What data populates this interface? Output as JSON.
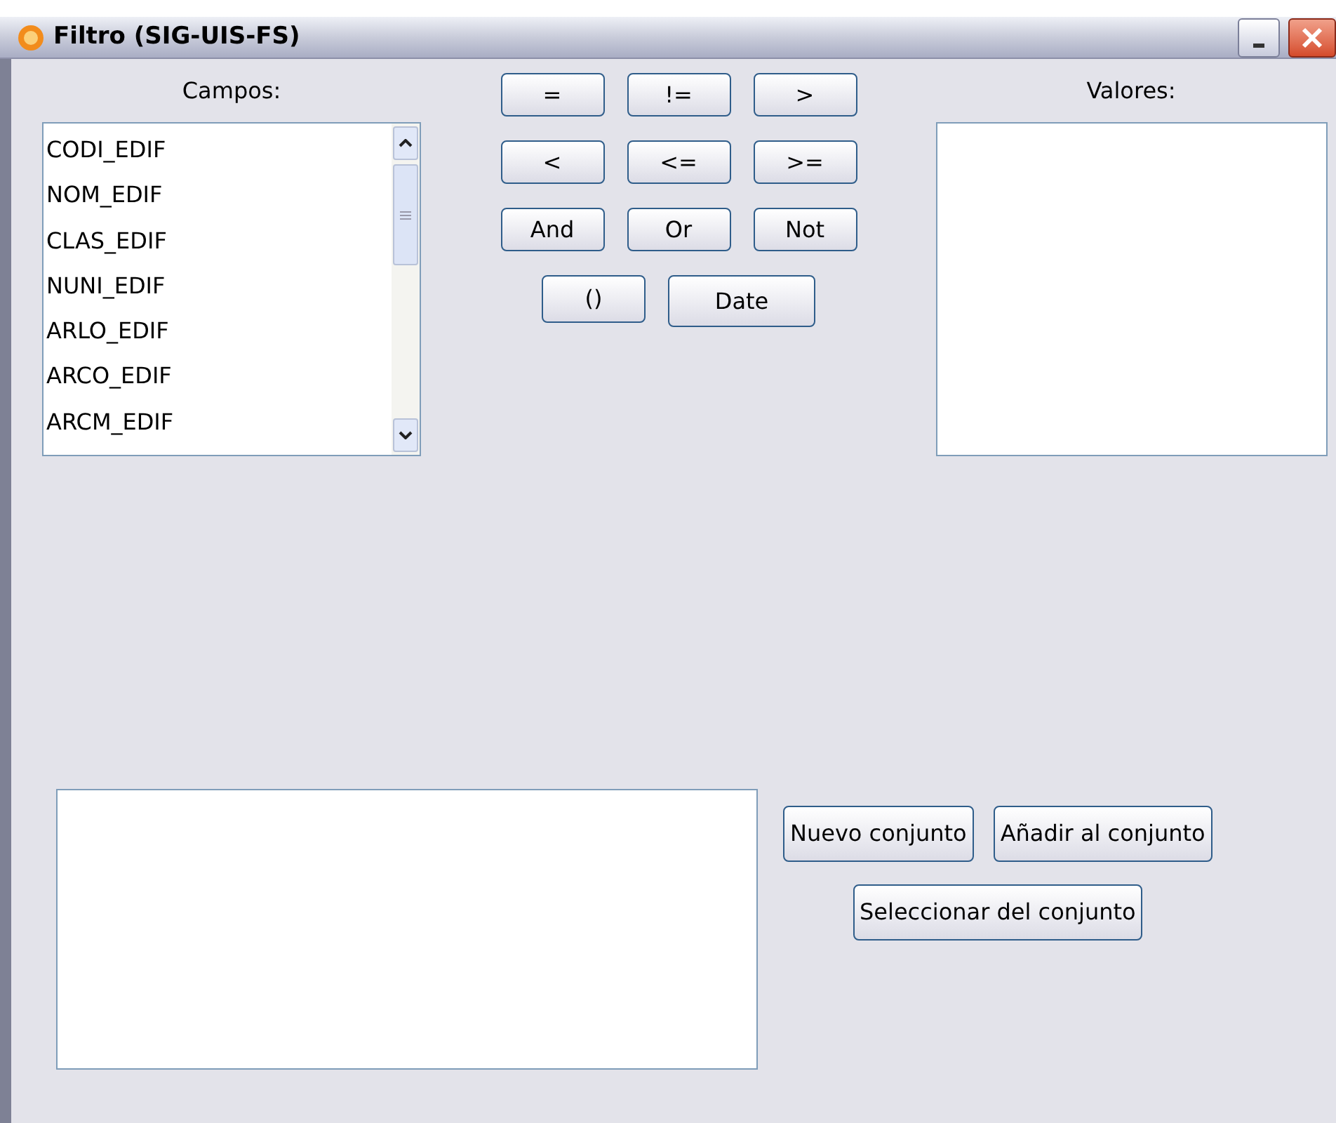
{
  "window": {
    "title": "Filtro (SIG-UIS-FS)"
  },
  "fields": {
    "label": "Campos:",
    "items": [
      "CODI_EDIF",
      "NOM_EDIF",
      "CLAS_EDIF",
      "NUNI_EDIF",
      "ARLO_EDIF",
      "ARCO_EDIF",
      "ARCM_EDIF"
    ]
  },
  "operators": [
    [
      "=",
      "!=",
      ">"
    ],
    [
      "<",
      "<=",
      ">="
    ],
    [
      "And",
      "Or",
      "Not"
    ],
    [
      "()",
      "Date"
    ]
  ],
  "values": {
    "label": "Valores:"
  },
  "set_buttons": [
    "Nuevo conjunto",
    "Añadir al conjunto",
    "Seleccionar del conjunto"
  ]
}
